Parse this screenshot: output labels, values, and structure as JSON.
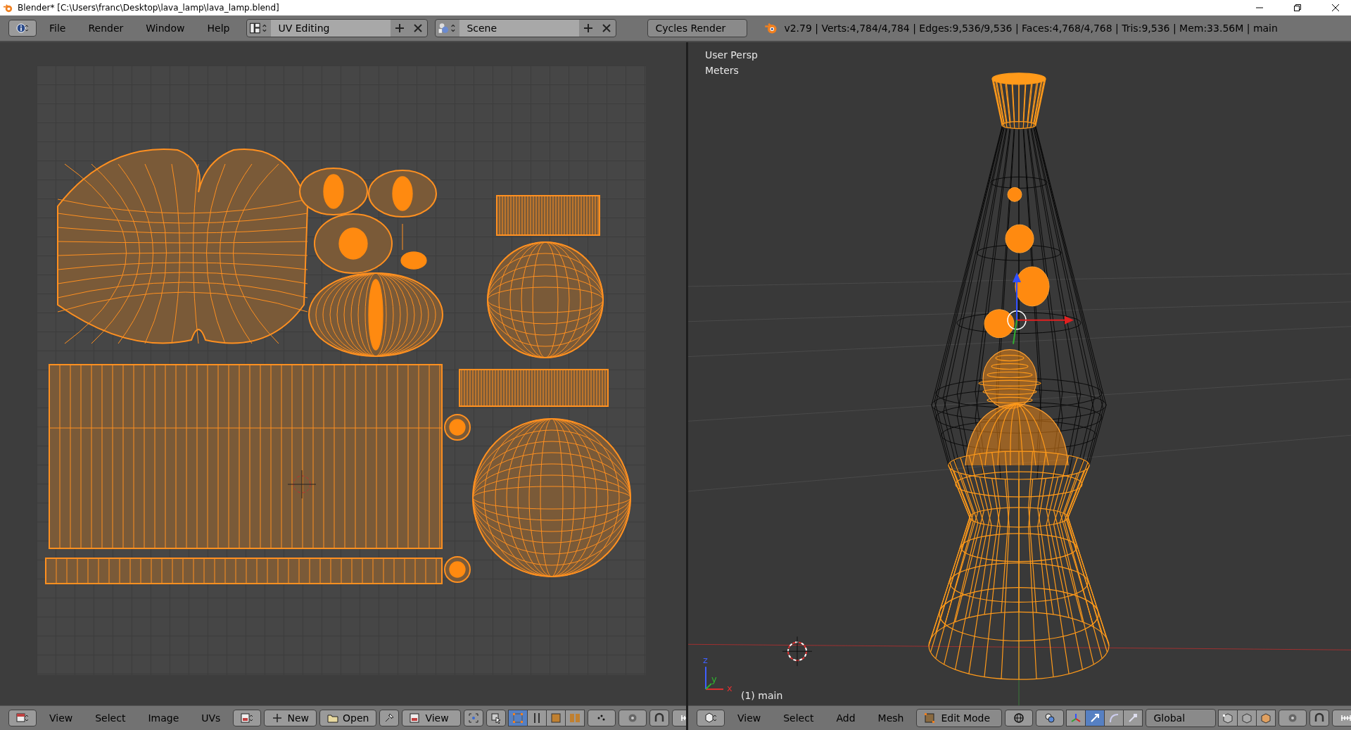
{
  "title_bar": {
    "title": "Blender* [C:\\Users\\franc\\Desktop\\lava_lamp\\lava_lamp.blend]"
  },
  "info_header": {
    "menus": [
      "File",
      "Render",
      "Window",
      "Help"
    ],
    "screen_layout": "UV Editing",
    "scene": "Scene",
    "render_engine": "Cycles Render",
    "stats": "v2.79 | Verts:4,784/4,784 | Edges:9,536/9,536 | Faces:4,768/4,768 | Tris:9,536 | Mem:33.56M | main"
  },
  "uv_editor": {
    "header": {
      "menus": [
        "View",
        "Select",
        "Image",
        "UVs"
      ],
      "new_button": "New",
      "open_button": "Open",
      "view_mode": "View",
      "select_modes": [
        {
          "kind": "vertex",
          "selected": true
        },
        {
          "kind": "edge",
          "selected": false
        },
        {
          "kind": "face",
          "selected": false
        },
        {
          "kind": "island",
          "selected": false
        }
      ]
    }
  },
  "view_3d": {
    "view_name": "User Persp",
    "units": "Meters",
    "axis_labels": [
      "z",
      "y",
      "x"
    ],
    "object_label": "(1) main",
    "header": {
      "menus": [
        "View",
        "Select",
        "Add",
        "Mesh"
      ],
      "mode": "Edit Mode",
      "transform_orientation": "Global",
      "manipulators": [
        {
          "kind": "axes",
          "selected": false
        },
        {
          "kind": "translate",
          "selected": true
        },
        {
          "kind": "rotate",
          "selected": false
        },
        {
          "kind": "scale",
          "selected": false
        }
      ]
    }
  }
}
